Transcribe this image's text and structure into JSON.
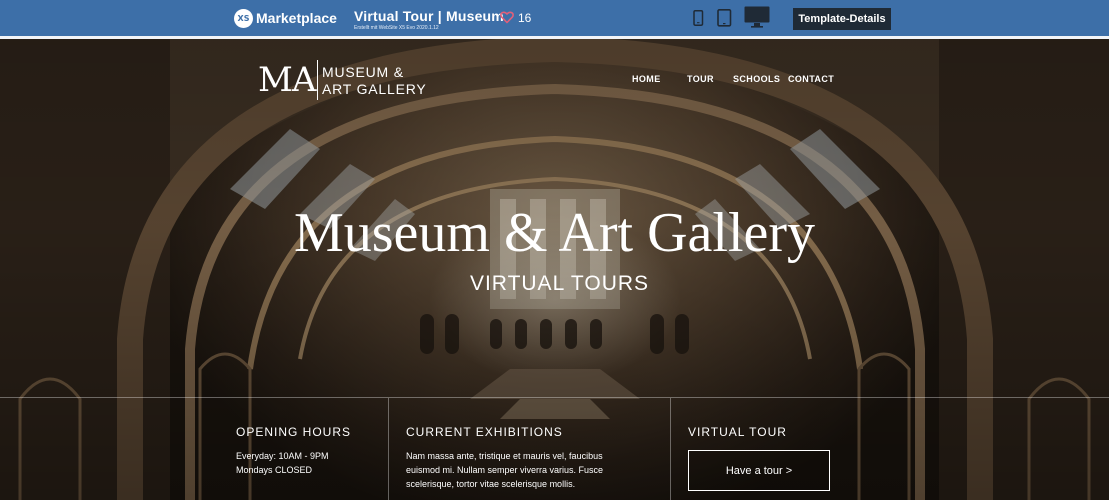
{
  "topbar": {
    "brand_logo": "XS",
    "brand": "Marketplace",
    "template_title": "Virtual Tour | Museum",
    "template_subtitle": "Erstellt mit WebSite X5 Evo 2020.1.12",
    "like_count": "16",
    "details_button": "Template-Details",
    "devices": [
      "phone-icon",
      "tablet-icon",
      "desktop-icon"
    ],
    "colors": {
      "bar": "#3d6fa8",
      "button": "#1f2a36",
      "heart": "#e0607a"
    }
  },
  "site": {
    "logo_mark": "MA",
    "logo_line1": "MUSEUM &",
    "logo_line2": "ART GALLERY",
    "nav": [
      "HOME",
      "TOUR",
      "SCHOOLS",
      "CONTACT"
    ],
    "hero_title": "Museum & Art Gallery",
    "hero_subtitle": "VIRTUAL TOURS"
  },
  "info": {
    "hours_heading": "OPENING HOURS",
    "hours_line1": "Everyday: 10AM - 9PM",
    "hours_line2": "Mondays CLOSED",
    "exhibitions_heading": "CURRENT EXHIBITIONS",
    "exhibitions_line1": "Nam massa ante, tristique et mauris vel, faucibus",
    "exhibitions_line2": "euismod mi. Nullam semper viverra varius. Fusce",
    "exhibitions_line3": "scelerisque, tortor vitae scelerisque mollis.",
    "tour_heading": "VIRTUAL TOUR",
    "tour_button": "Have a tour >"
  }
}
